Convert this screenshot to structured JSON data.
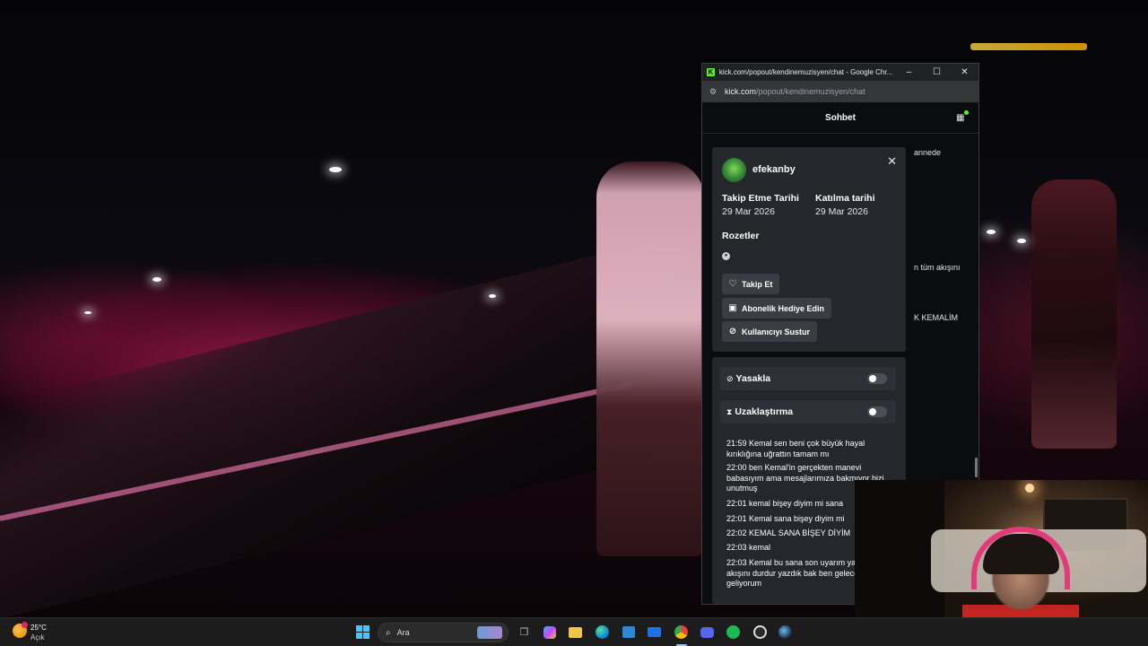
{
  "window": {
    "title": "kick.com/popout/kendinemuzisyen/chat - Google Chr...",
    "url_host": "kick.com",
    "url_path": "/popout/kendinemuzisyen/chat",
    "controls": {
      "minimize": "–",
      "maximize": "☐",
      "close": "✕"
    }
  },
  "chat": {
    "header_title": "Sohbet",
    "background_fragments": [
      "annede",
      "n tüm akışını",
      "K KEMALİM"
    ]
  },
  "user_card": {
    "username": "efekanby",
    "follow_date_label": "Takip Etme Tarihi",
    "follow_date": "29 Mar 2026",
    "join_date_label": "Katılma tarihi",
    "join_date": "29 Mar 2026",
    "badges_label": "Rozetler",
    "buttons": {
      "follow": "Takip Et",
      "gift_sub": "Abonelik Hediye Edin",
      "mute": "Kullanıcıyı Sustur"
    }
  },
  "moderation": {
    "ban_label": "Yasakla",
    "ban_enabled": false,
    "timeout_label": "Uzaklaştırma",
    "timeout_enabled": false,
    "messages": [
      "21:59 Kemal sen beni çok büyük hayal kırıklığına uğrattın tamam mı",
      "22:00 ben Kemal'in gerçekten manevi babasıyım ama mesajlarımıza bakmıyor bizi unutmuş",
      "22:01 kemal bişey diyim mi sana",
      "22:01 Kemal sana bişey diyim mi",
      "22:02 KEMAL SANA BİŞEY DİYİM",
      "22:03 kemal",
      "22:03 Kemal bu sana son uyarım yayının tüm akışını durdur yazdık bak ben gelecekten geliyorum"
    ]
  },
  "taskbar": {
    "temperature": "25°C",
    "condition": "Açık",
    "search_placeholder": "Ara"
  },
  "colors": {
    "kick_green": "#53fc18",
    "card_bg": "#24272c",
    "button_bg": "#3a3e44",
    "taskbar_bg": "#1c1c1c"
  }
}
